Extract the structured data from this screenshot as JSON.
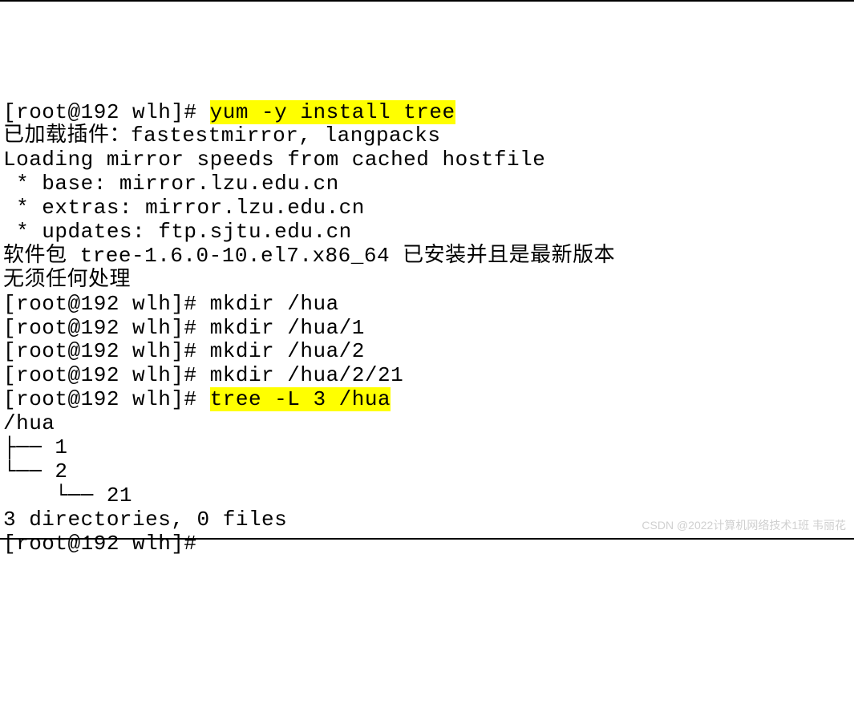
{
  "terminal": {
    "lines": [
      {
        "prompt": "[root@192 wlh]# ",
        "cmd_hl": "yum -y install tree",
        "rest": ""
      },
      {
        "text": "已加载插件：fastestmirror, langpacks"
      },
      {
        "text": "Loading mirror speeds from cached hostfile"
      },
      {
        "text": " * base: mirror.lzu.edu.cn"
      },
      {
        "text": " * extras: mirror.lzu.edu.cn"
      },
      {
        "text": " * updates: ftp.sjtu.edu.cn"
      },
      {
        "text": "软件包 tree-1.6.0-10.el7.x86_64 已安装并且是最新版本"
      },
      {
        "text": "无须任何处理"
      },
      {
        "prompt": "[root@192 wlh]# ",
        "cmd": "mkdir /hua"
      },
      {
        "prompt": "[root@192 wlh]# ",
        "cmd": "mkdir /hua/1"
      },
      {
        "prompt": "[root@192 wlh]# ",
        "cmd": "mkdir /hua/2"
      },
      {
        "prompt": "[root@192 wlh]# ",
        "cmd": "mkdir /hua/2/21"
      },
      {
        "prompt": "[root@192 wlh]# ",
        "cmd_hl": "tree -L 3 /hua",
        "rest": ""
      },
      {
        "text": "/hua"
      },
      {
        "text": "├── 1"
      },
      {
        "text": "└── 2"
      },
      {
        "text": "    └── 21"
      },
      {
        "text": ""
      },
      {
        "text": "3 directories, 0 files"
      },
      {
        "prompt": "[root@192 wlh]# ",
        "cmd": ""
      }
    ]
  },
  "watermark": "CSDN @2022计算机网络技术1班 韦丽花"
}
